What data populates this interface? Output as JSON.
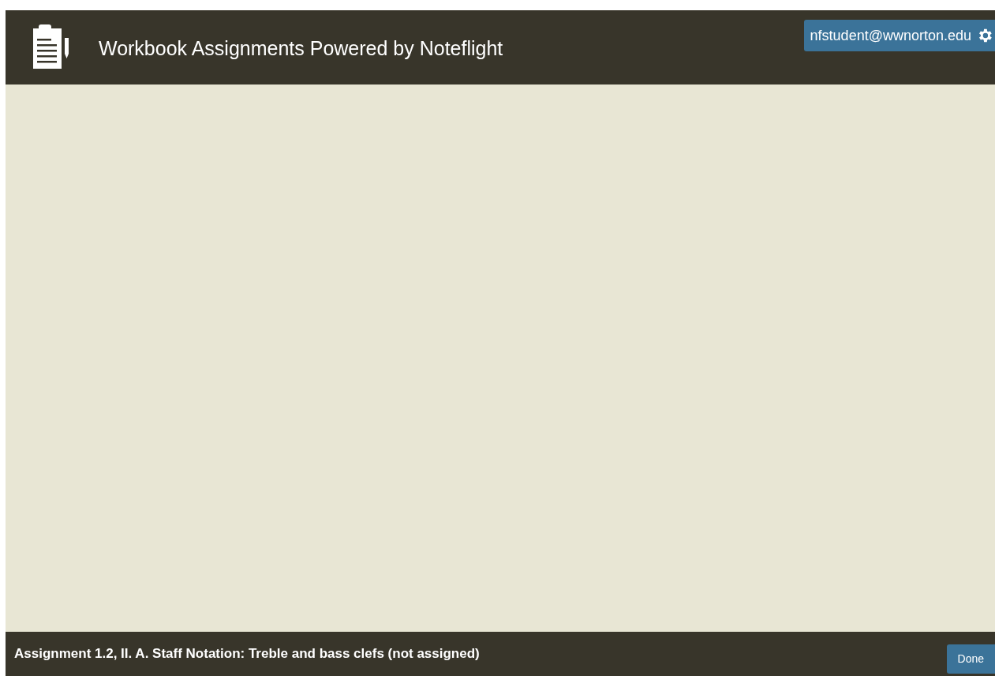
{
  "header": {
    "title": "Workbook Assignments Powered by Noteflight",
    "user_button": "nfstudent@wwnorton.edu"
  },
  "footer": {
    "assignment": "Assignment 1.2, II. A. Staff Notation: Treble and bass clefs (not assigned)",
    "done_button": "Done"
  }
}
